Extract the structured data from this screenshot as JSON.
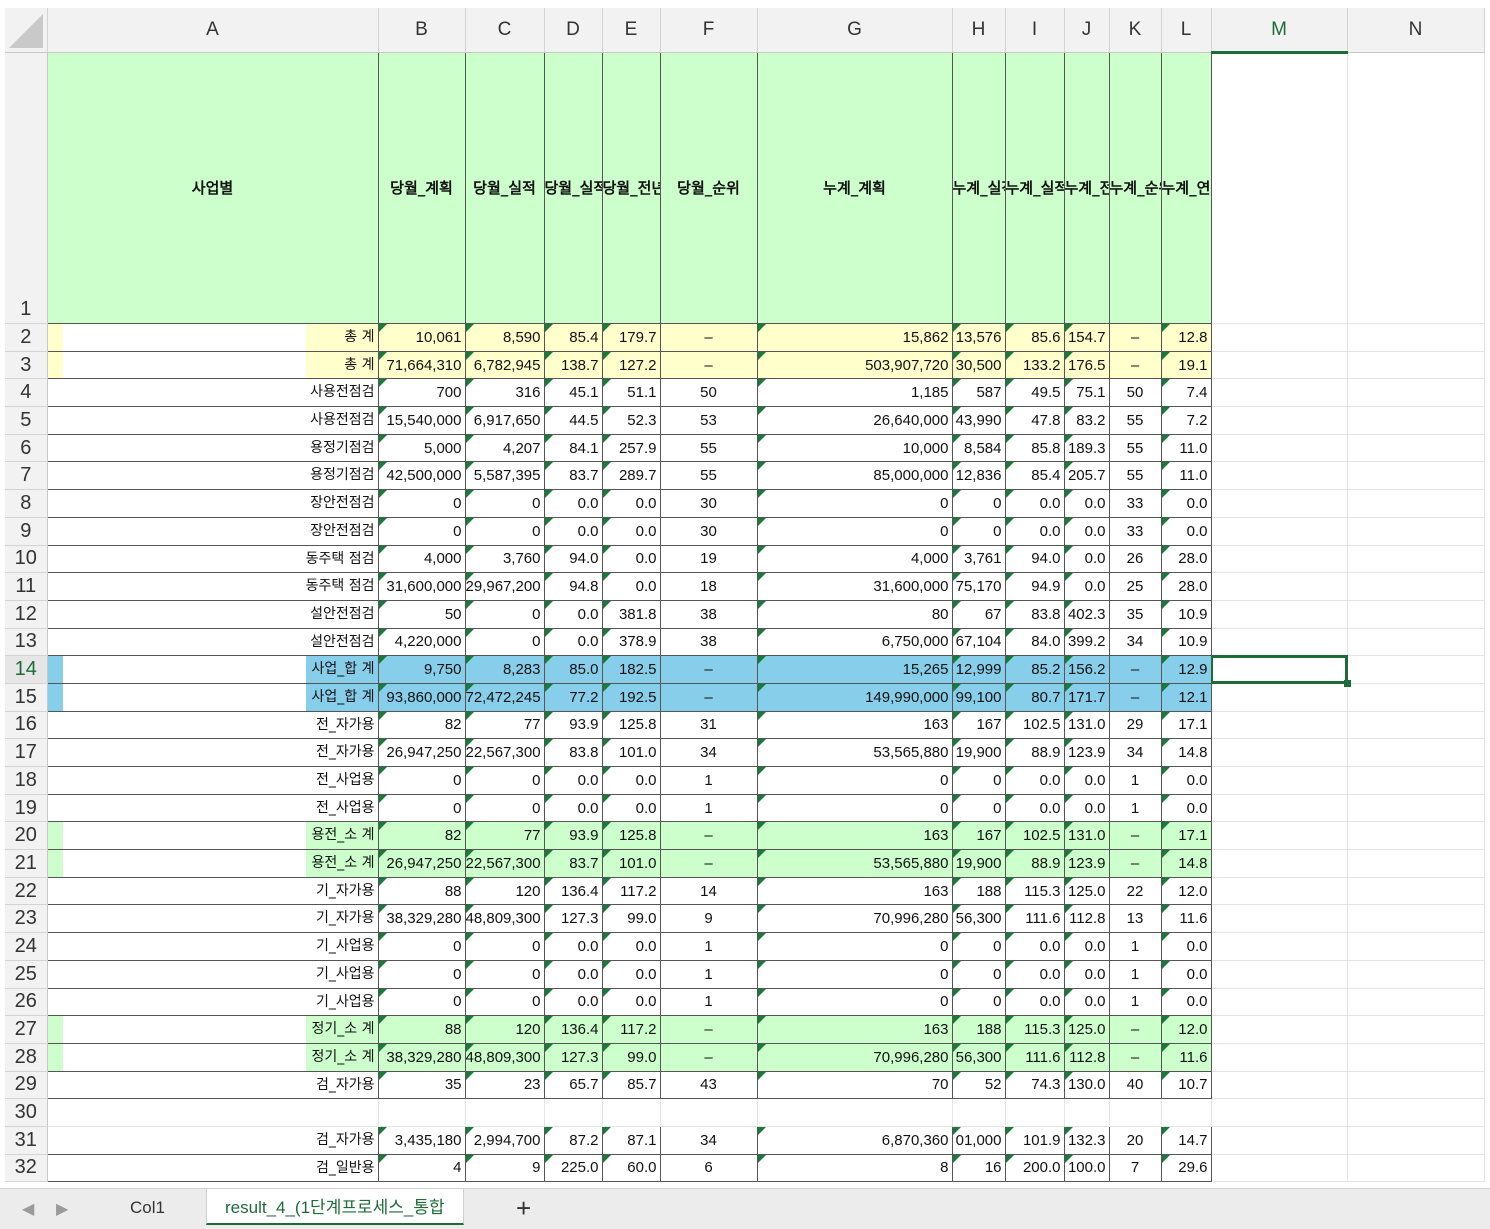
{
  "columns": [
    "",
    "A",
    "B",
    "C",
    "D",
    "E",
    "F",
    "G",
    "H",
    "I",
    "J",
    "K",
    "L",
    "M",
    "N"
  ],
  "header_row": {
    "num": "1",
    "cells": [
      "사업별",
      "당월_계획",
      "당월_실적",
      "당월_실적률",
      "당월_전년동기실적률",
      "당월_순위",
      "누계_계획",
      "누계_실적",
      "누계_실적률",
      "누계_전년동기실적률",
      "누계_순위",
      "누계_연간진도율"
    ]
  },
  "rows": [
    {
      "num": "2",
      "style": "r-yellow",
      "label": "총  계",
      "v": [
        "10,061",
        "8,590",
        "85.4",
        "179.7",
        "–",
        "15,862",
        "13,576",
        "85.6",
        "154.7",
        "–",
        "12.8"
      ]
    },
    {
      "num": "3",
      "style": "r-yellow",
      "label": "총  계",
      "v": [
        "71,664,310",
        "6,782,945",
        "138.7",
        "127.2",
        "–",
        "503,907,720",
        "30,500",
        "133.2",
        "176.5",
        "–",
        "19.1"
      ]
    },
    {
      "num": "4",
      "style": "",
      "label": "사용전점검",
      "v": [
        "700",
        "316",
        "45.1",
        "51.1",
        "50",
        "1,185",
        "587",
        "49.5",
        "75.1",
        "50",
        "7.4"
      ]
    },
    {
      "num": "5",
      "style": "",
      "label": "사용전점검",
      "v": [
        "15,540,000",
        "6,917,650",
        "44.5",
        "52.3",
        "53",
        "26,640,000",
        "43,990",
        "47.8",
        "83.2",
        "55",
        "7.2"
      ]
    },
    {
      "num": "6",
      "style": "",
      "label": "용정기점검",
      "v": [
        "5,000",
        "4,207",
        "84.1",
        "257.9",
        "55",
        "10,000",
        "8,584",
        "85.8",
        "189.3",
        "55",
        "11.0"
      ]
    },
    {
      "num": "7",
      "style": "",
      "label": "용정기점검",
      "v": [
        "42,500,000",
        "5,587,395",
        "83.7",
        "289.7",
        "55",
        "85,000,000",
        "12,836",
        "85.4",
        "205.7",
        "55",
        "11.0"
      ]
    },
    {
      "num": "8",
      "style": "",
      "label": "장안전점검",
      "v": [
        "0",
        "0",
        "0.0",
        "0.0",
        "30",
        "0",
        "0",
        "0.0",
        "0.0",
        "33",
        "0.0"
      ]
    },
    {
      "num": "9",
      "style": "",
      "label": "장안전점검",
      "v": [
        "0",
        "0",
        "0.0",
        "0.0",
        "30",
        "0",
        "0",
        "0.0",
        "0.0",
        "33",
        "0.0"
      ]
    },
    {
      "num": "10",
      "style": "",
      "label": "동주택 점검",
      "v": [
        "4,000",
        "3,760",
        "94.0",
        "0.0",
        "19",
        "4,000",
        "3,761",
        "94.0",
        "0.0",
        "26",
        "28.0"
      ]
    },
    {
      "num": "11",
      "style": "",
      "label": "동주택 점검",
      "v": [
        "31,600,000",
        "29,967,200",
        "94.8",
        "0.0",
        "18",
        "31,600,000",
        "75,170",
        "94.9",
        "0.0",
        "25",
        "28.0"
      ]
    },
    {
      "num": "12",
      "style": "",
      "label": "설안전점검",
      "v": [
        "50",
        "0",
        "0.0",
        "381.8",
        "38",
        "80",
        "67",
        "83.8",
        "402.3",
        "35",
        "10.9"
      ]
    },
    {
      "num": "13",
      "style": "",
      "label": "설안전점검",
      "v": [
        "4,220,000",
        "0",
        "0.0",
        "378.9",
        "38",
        "6,750,000",
        "67,104",
        "84.0",
        "399.2",
        "34",
        "10.9"
      ]
    },
    {
      "num": "14",
      "style": "r-blue",
      "label": "사업_합  계",
      "v": [
        "9,750",
        "8,283",
        "85.0",
        "182.5",
        "–",
        "15,265",
        "12,999",
        "85.2",
        "156.2",
        "–",
        "12.9"
      ]
    },
    {
      "num": "15",
      "style": "r-blue",
      "label": "사업_합  계",
      "v": [
        "93,860,000",
        "72,472,245",
        "77.2",
        "192.5",
        "–",
        "149,990,000",
        "99,100",
        "80.7",
        "171.7",
        "–",
        "12.1"
      ]
    },
    {
      "num": "16",
      "style": "",
      "label": "전_자가용",
      "v": [
        "82",
        "77",
        "93.9",
        "125.8",
        "31",
        "163",
        "167",
        "102.5",
        "131.0",
        "29",
        "17.1"
      ]
    },
    {
      "num": "17",
      "style": "",
      "label": "전_자가용",
      "v": [
        "26,947,250",
        "22,567,300",
        "83.8",
        "101.0",
        "34",
        "53,565,880",
        "19,900",
        "88.9",
        "123.9",
        "34",
        "14.8"
      ]
    },
    {
      "num": "18",
      "style": "",
      "label": "전_사업용",
      "v": [
        "0",
        "0",
        "0.0",
        "0.0",
        "1",
        "0",
        "0",
        "0.0",
        "0.0",
        "1",
        "0.0"
      ]
    },
    {
      "num": "19",
      "style": "",
      "label": "전_사업용",
      "v": [
        "0",
        "0",
        "0.0",
        "0.0",
        "1",
        "0",
        "0",
        "0.0",
        "0.0",
        "1",
        "0.0"
      ]
    },
    {
      "num": "20",
      "style": "r-green",
      "label": "용전_소  계",
      "v": [
        "82",
        "77",
        "93.9",
        "125.8",
        "–",
        "163",
        "167",
        "102.5",
        "131.0",
        "–",
        "17.1"
      ]
    },
    {
      "num": "21",
      "style": "r-green",
      "label": "용전_소  계",
      "v": [
        "26,947,250",
        "22,567,300",
        "83.7",
        "101.0",
        "–",
        "53,565,880",
        "19,900",
        "88.9",
        "123.9",
        "–",
        "14.8"
      ]
    },
    {
      "num": "22",
      "style": "",
      "label": "기_자가용",
      "v": [
        "88",
        "120",
        "136.4",
        "117.2",
        "14",
        "163",
        "188",
        "115.3",
        "125.0",
        "22",
        "12.0"
      ]
    },
    {
      "num": "23",
      "style": "",
      "label": "기_자가용",
      "v": [
        "38,329,280",
        "48,809,300",
        "127.3",
        "99.0",
        "9",
        "70,996,280",
        "56,300",
        "111.6",
        "112.8",
        "13",
        "11.6"
      ]
    },
    {
      "num": "24",
      "style": "",
      "label": "기_사업용",
      "v": [
        "0",
        "0",
        "0.0",
        "0.0",
        "1",
        "0",
        "0",
        "0.0",
        "0.0",
        "1",
        "0.0"
      ]
    },
    {
      "num": "25",
      "style": "",
      "label": "기_사업용",
      "v": [
        "0",
        "0",
        "0.0",
        "0.0",
        "1",
        "0",
        "0",
        "0.0",
        "0.0",
        "1",
        "0.0"
      ]
    },
    {
      "num": "26",
      "style": "",
      "label": "기_사업용",
      "v": [
        "0",
        "0",
        "0.0",
        "0.0",
        "1",
        "0",
        "0",
        "0.0",
        "0.0",
        "1",
        "0.0"
      ]
    },
    {
      "num": "27",
      "style": "r-green",
      "label": "정기_소  계",
      "v": [
        "88",
        "120",
        "136.4",
        "117.2",
        "–",
        "163",
        "188",
        "115.3",
        "125.0",
        "–",
        "12.0"
      ]
    },
    {
      "num": "28",
      "style": "r-green",
      "label": "정기_소  계",
      "v": [
        "38,329,280",
        "48,809,300",
        "127.3",
        "99.0",
        "–",
        "70,996,280",
        "56,300",
        "111.6",
        "112.8",
        "–",
        "11.6"
      ]
    },
    {
      "num": "29",
      "style": "",
      "label": "검_자가용",
      "v": [
        "35",
        "23",
        "65.7",
        "85.7",
        "43",
        "70",
        "52",
        "74.3",
        "130.0",
        "40",
        "10.7"
      ]
    },
    {
      "num": "30",
      "style": "blank",
      "label": "",
      "v": [
        "",
        "",
        "",
        "",
        "",
        "",
        "",
        "",
        "",
        "",
        ""
      ]
    },
    {
      "num": "31",
      "style": "",
      "label": "검_자가용",
      "v": [
        "3,435,180",
        "2,994,700",
        "87.2",
        "87.1",
        "34",
        "6,870,360",
        "01,000",
        "101.9",
        "132.3",
        "20",
        "14.7"
      ]
    },
    {
      "num": "32",
      "style": "",
      "label": "검_일반용",
      "v": [
        "4",
        "9",
        "225.0",
        "60.0",
        "6",
        "8",
        "16",
        "200.0",
        "100.0",
        "7",
        "29.6"
      ]
    }
  ],
  "sheet_tabs": {
    "prev_icon": "◀",
    "next_icon": "▶",
    "tabs": [
      "Col1",
      "result_4_(1단계프로세스_통합"
    ],
    "active_tab": "result_4_(1단계프로세스_통합",
    "add_label": "+"
  },
  "selection": {
    "cell": "M14",
    "accent_color": "#1e6b38"
  },
  "colors": {
    "yellow_row": "#ffffcc",
    "blue_row": "#87ceeb",
    "green_row": "#ccffcc",
    "header_fill": "#ccffcc"
  }
}
